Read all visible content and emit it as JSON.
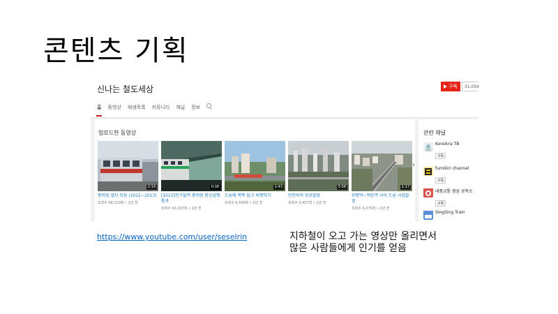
{
  "slide": {
    "title": "콘텐츠 기획",
    "link": "https://www.youtube.com/user/seselrin",
    "description_lines": [
      "지하철이 오고 가는 영상만 올리면서",
      "많은 사람들에게 인기를 얻음"
    ]
  },
  "channel": {
    "name": "신나는 철도세상",
    "subscribe_label": "구독",
    "subscriber_count": "31,054",
    "tabs": [
      "홈",
      "동영상",
      "재생목록",
      "커뮤니티",
      "채널",
      "정보"
    ],
    "active_tab": "홈"
  },
  "uploads": {
    "section_title": "업로드한 동영상",
    "videos": [
      {
        "title": "중저형 열차 모음 (2012~2013)",
        "meta": "조회수 98,120회 • 2년 전",
        "duration": "2:14"
      },
      {
        "title": "[2013]전구밀역 중저형 중산급행 통과",
        "meta": "조회수 93,207회 • 2년 전",
        "duration": "0:38"
      },
      {
        "title": "드론에 쪽쪽 담고 비행하기",
        "meta": "조회수 6,569회 • 2년 전",
        "duration": "1:43"
      },
      {
        "title": "인천지역 항공촬영",
        "meta": "조회수 5,457회 • 2년 전",
        "duration": "5:58"
      },
      {
        "title": "부평역~백운역 사이 드론 시험촬영",
        "meta": "조회수 4,375회 • 2년 전",
        "duration": "1:17"
      }
    ]
  },
  "related": {
    "title": "관련 채널",
    "subscribe_label": "구독",
    "channels": [
      {
        "name": "Koreikra TB"
      },
      {
        "name": "fumikiri channel"
      },
      {
        "name": "대중교통 영상 공작소"
      },
      {
        "name": "SingSing Train"
      }
    ]
  },
  "colors": {
    "youtube_red": "#e62117",
    "link_blue": "#0563c1",
    "video_title_blue": "#167ac6"
  },
  "icons": [
    "play-icon",
    "search-icon",
    "chevron-right-icon"
  ]
}
